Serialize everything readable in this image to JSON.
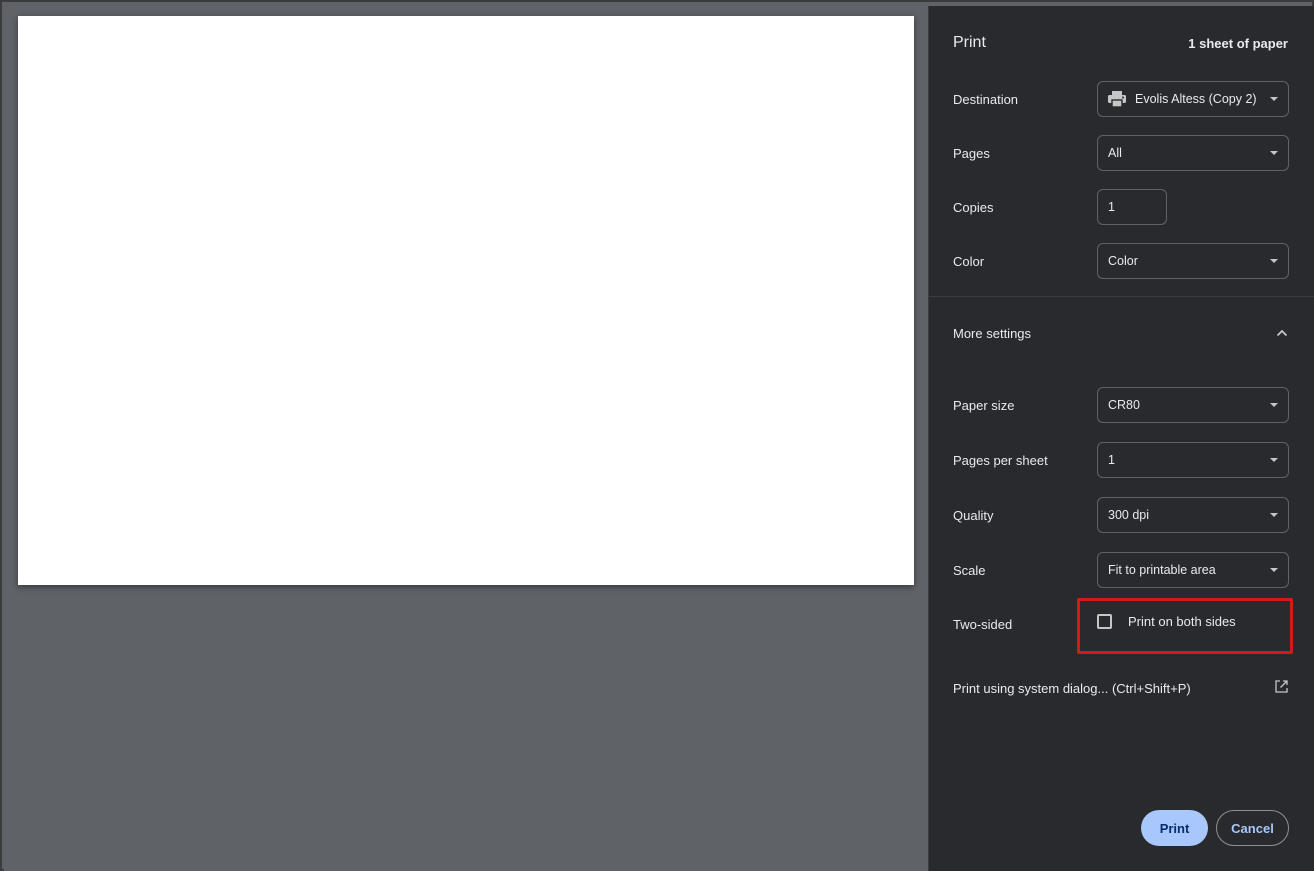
{
  "header": {
    "title": "Print",
    "sheet_count": "1 sheet of paper"
  },
  "settings": {
    "destination": {
      "label": "Destination",
      "value": "Evolis Altess (Copy 2)",
      "icon": "printer-icon"
    },
    "pages": {
      "label": "Pages",
      "value": "All"
    },
    "copies": {
      "label": "Copies",
      "value": "1"
    },
    "color": {
      "label": "Color",
      "value": "Color"
    }
  },
  "more_settings": {
    "label": "More settings",
    "icon": "chevron-up-icon",
    "paper_size": {
      "label": "Paper size",
      "value": "CR80"
    },
    "pages_per_sheet": {
      "label": "Pages per sheet",
      "value": "1"
    },
    "quality": {
      "label": "Quality",
      "value": "300 dpi"
    },
    "scale": {
      "label": "Scale",
      "value": "Fit to printable area"
    },
    "two_sided": {
      "label": "Two-sided",
      "option": "Print on both sides",
      "checked": false
    }
  },
  "system_dialog": {
    "label": "Print using system dialog... (Ctrl+Shift+P)",
    "icon": "open-external-icon"
  },
  "actions": {
    "print": "Print",
    "cancel": "Cancel"
  },
  "colors": {
    "accent": "#a8c7fa",
    "highlight": "#d11a1a",
    "sidebar_bg": "#292a2d",
    "preview_bg": "#5f6267"
  }
}
